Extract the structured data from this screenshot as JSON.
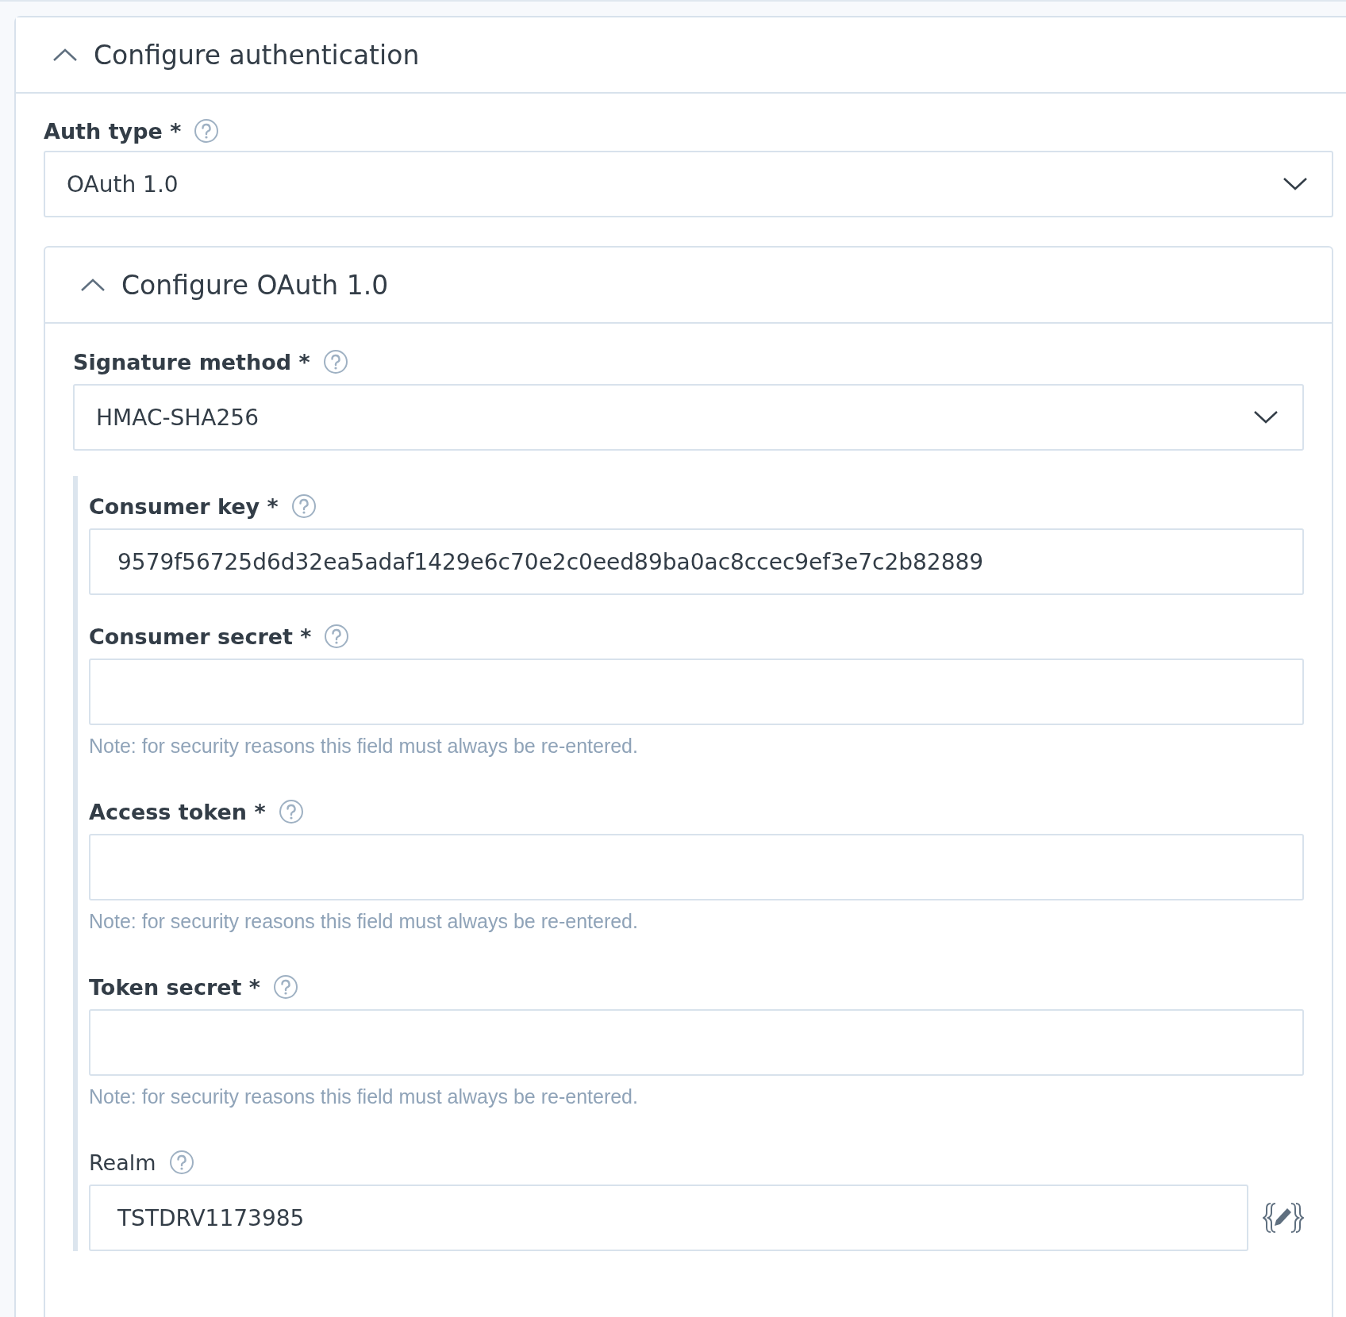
{
  "section": {
    "title": "Configure authentication",
    "expanded": true
  },
  "auth_type": {
    "label": "Auth type *",
    "required": true,
    "value": "OAuth 1.0"
  },
  "oauth": {
    "title": "Configure OAuth 1.0",
    "expanded": true,
    "signature_method": {
      "label": "Signature method *",
      "required": true,
      "value": "HMAC-SHA256"
    },
    "fields": [
      {
        "kind": "text",
        "label": "Consumer key *",
        "required": true,
        "value": "9579f56725d6d32ea5adaf1429e6c70e2c0eed89ba0ac8ccec9ef3e7c2b82889"
      },
      {
        "kind": "text",
        "label": "Consumer secret *",
        "required": true,
        "note": "Note: for security reasons this field must always be re-entered."
      },
      {
        "kind": "text",
        "label": "Access token *",
        "required": true,
        "note": "Note: for security reasons this field must always be re-entered."
      },
      {
        "kind": "text",
        "label": "Token secret *",
        "required": true,
        "note": "Note: for security reasons this field must always be re-entered."
      },
      {
        "kind": "expression",
        "label": "Realm",
        "required": false,
        "value": "TSTDRV1173985"
      }
    ]
  }
}
